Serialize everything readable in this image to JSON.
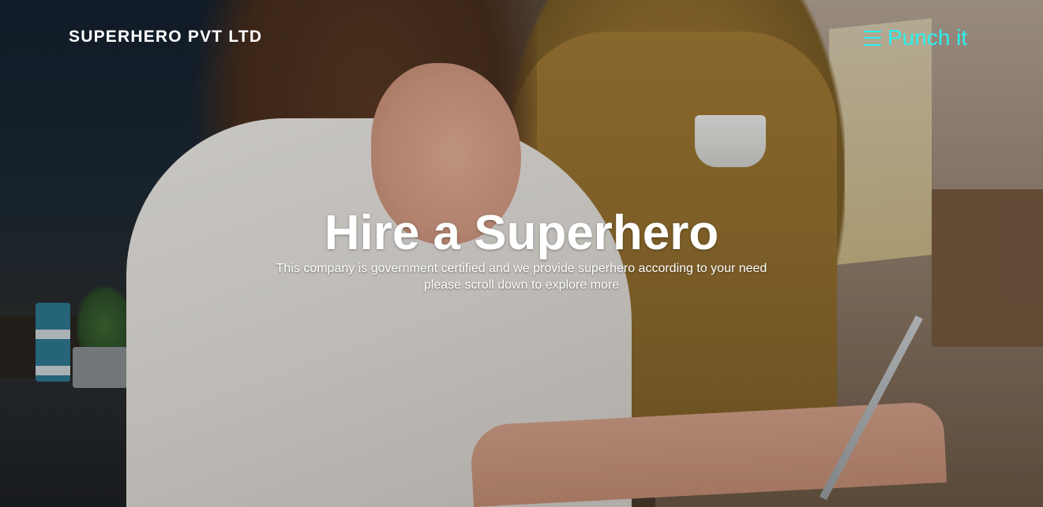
{
  "header": {
    "brand": "SUPERHERO PVT LTD",
    "nav_toggle_label": "Punch it",
    "nav_toggle_icon": "hamburger-menu-icon",
    "accent_color": "#2bf0ee"
  },
  "hero": {
    "title": "Hire a Superhero",
    "subtitle_line1": "This company is government certified and we provide superhero according to your need",
    "subtitle_line2": "please scroll down to explore more"
  }
}
